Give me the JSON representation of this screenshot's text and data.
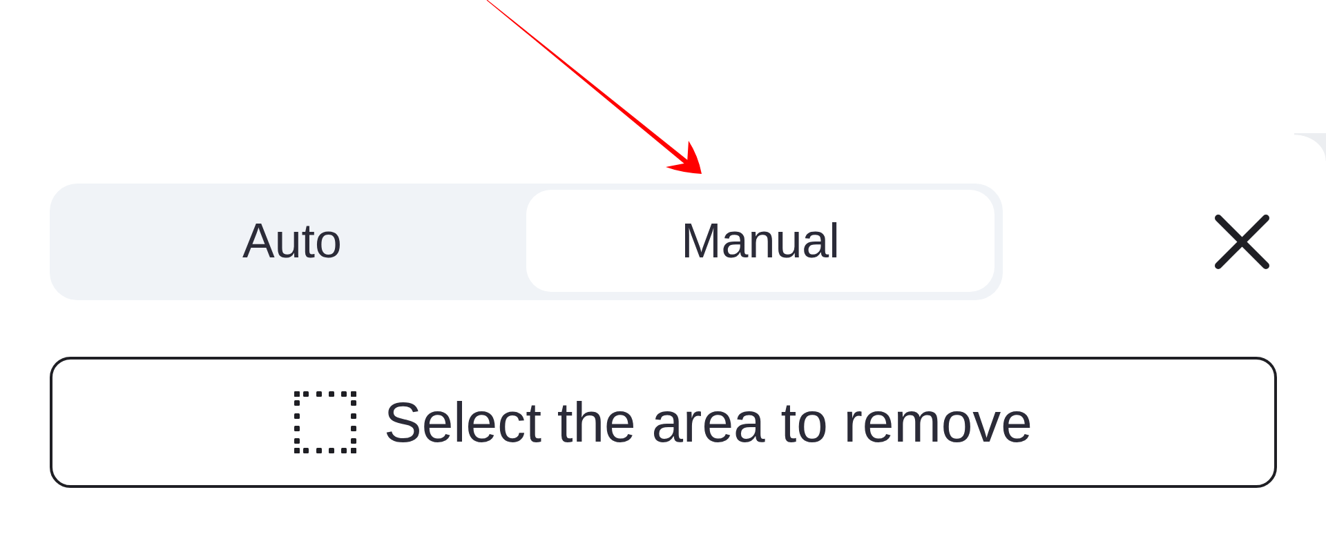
{
  "mode_tabs": [
    {
      "label": "Auto",
      "selected": false
    },
    {
      "label": "Manual",
      "selected": true
    }
  ],
  "select_area_button": {
    "label": "Select the area to remove"
  }
}
